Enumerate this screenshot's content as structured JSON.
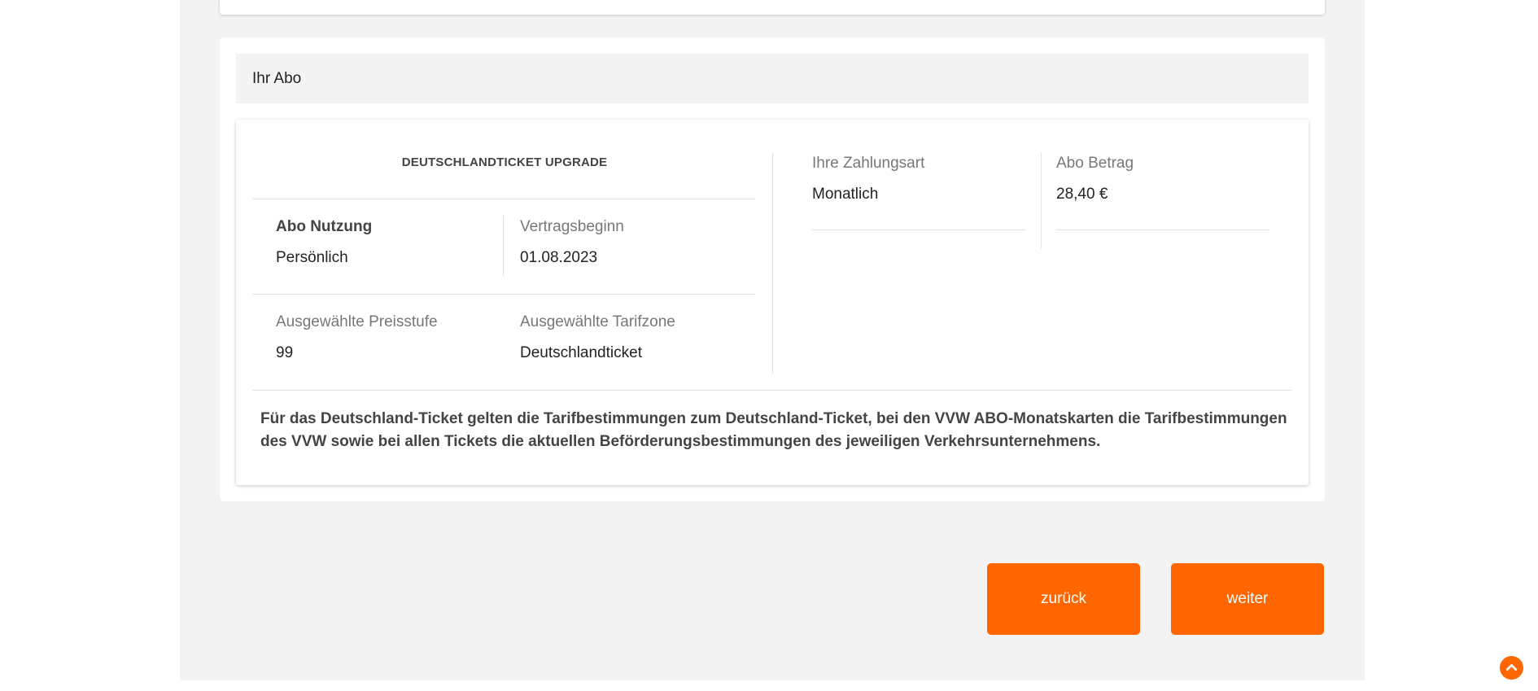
{
  "section": {
    "title": "Ihr Abo"
  },
  "abo": {
    "product_title": "DEUTSCHLANDTICKET UPGRADE",
    "usage_label": "Abo Nutzung",
    "usage_value": "Persönlich",
    "start_label": "Vertragsbeginn",
    "start_value": "01.08.2023",
    "price_level_label": "Ausgewählte Preisstufe",
    "price_level_value": "99",
    "zone_label": "Ausgewählte Tarifzone",
    "zone_value": "Deutschlandticket",
    "payment_label": "Ihre Zahlungsart",
    "payment_value": "Monatlich",
    "amount_label": "Abo Betrag",
    "amount_value": "28,40 €"
  },
  "note": "Für das Deutschland-Ticket gelten die Tarifbestimmungen zum Deutschland-Ticket, bei den VVW ABO-Monatskarten die Tarifbestimmungen des VVW sowie bei allen Tickets die aktuellen Beförderungsbestimmungen des jeweiligen Verkehrsunternehmens.",
  "buttons": {
    "back": "zurück",
    "next": "weiter"
  },
  "icons": {
    "scroll_top": "chevron-up-circle-icon"
  },
  "colors": {
    "accent": "#ff6600",
    "background": "#f3f3f3"
  }
}
